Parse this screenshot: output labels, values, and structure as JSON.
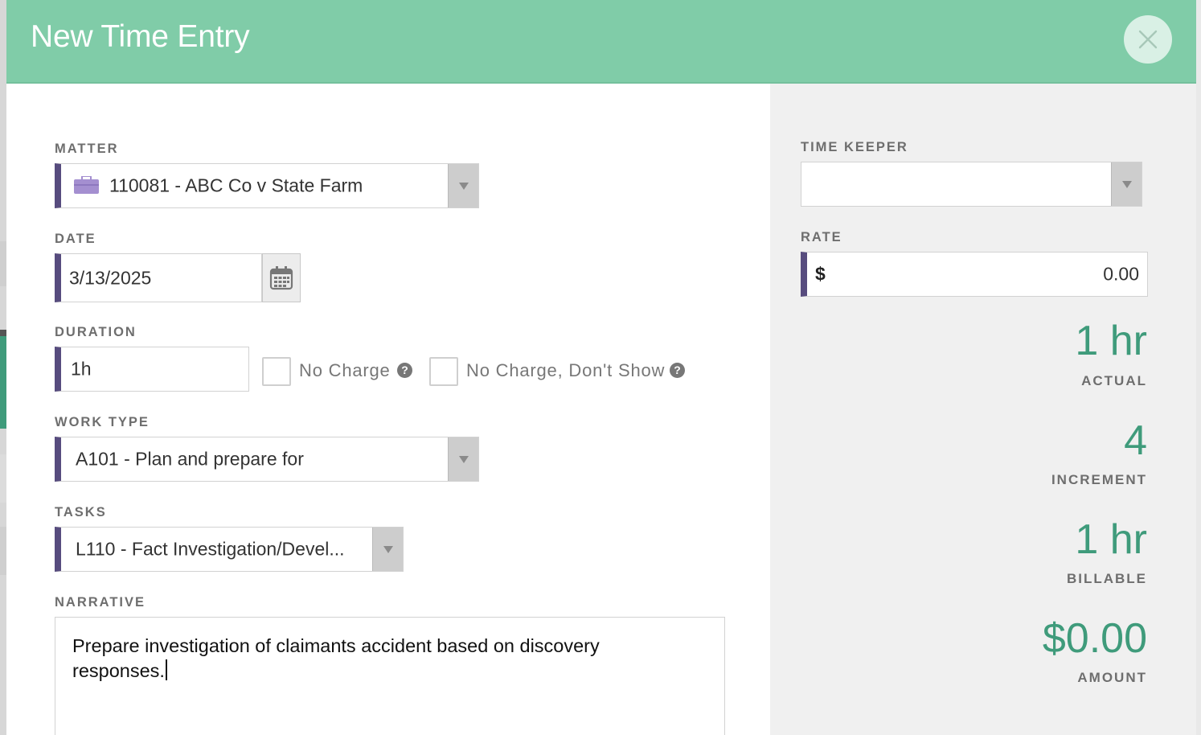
{
  "colors": {
    "header_bg": "#80cca8",
    "accent_bar": "#574c7e",
    "stat_green": "#3f9b7b",
    "right_pane_bg": "#f0f0f0",
    "matter_icon": "#a48fd0"
  },
  "modal": {
    "title": "New Time Entry",
    "close_icon": "close-icon"
  },
  "matter": {
    "label": "MATTER",
    "icon": "briefcase-icon",
    "value": "110081 - ABC Co v State Farm"
  },
  "date": {
    "label": "DATE",
    "value": "3/13/2025",
    "icon": "calendar-icon"
  },
  "duration": {
    "label": "DURATION",
    "value": "1h",
    "no_charge_label": "No Charge",
    "no_charge_dont_show_label": "No Charge, Don't Show",
    "no_charge_checked": false,
    "no_charge_dont_show_checked": false,
    "help_icon": "question-icon"
  },
  "work_type": {
    "label": "WORK TYPE",
    "value": "A101 - Plan and prepare for"
  },
  "tasks": {
    "label": "TASKS",
    "value": "L110 - Fact Investigation/Devel..."
  },
  "narrative": {
    "label": "NARRATIVE",
    "line1": "Prepare investigation of claimants accident based on discovery",
    "line2": "responses."
  },
  "time_keeper": {
    "label": "TIME KEEPER",
    "value": ""
  },
  "rate": {
    "label": "RATE",
    "currency": "$",
    "value": "0.00"
  },
  "stats": {
    "actual": {
      "value": "1 hr",
      "label": "ACTUAL"
    },
    "increment": {
      "value": "4",
      "label": "INCREMENT"
    },
    "billable": {
      "value": "1 hr",
      "label": "BILLABLE"
    },
    "amount": {
      "value": "$0.00",
      "label": "AMOUNT"
    }
  }
}
